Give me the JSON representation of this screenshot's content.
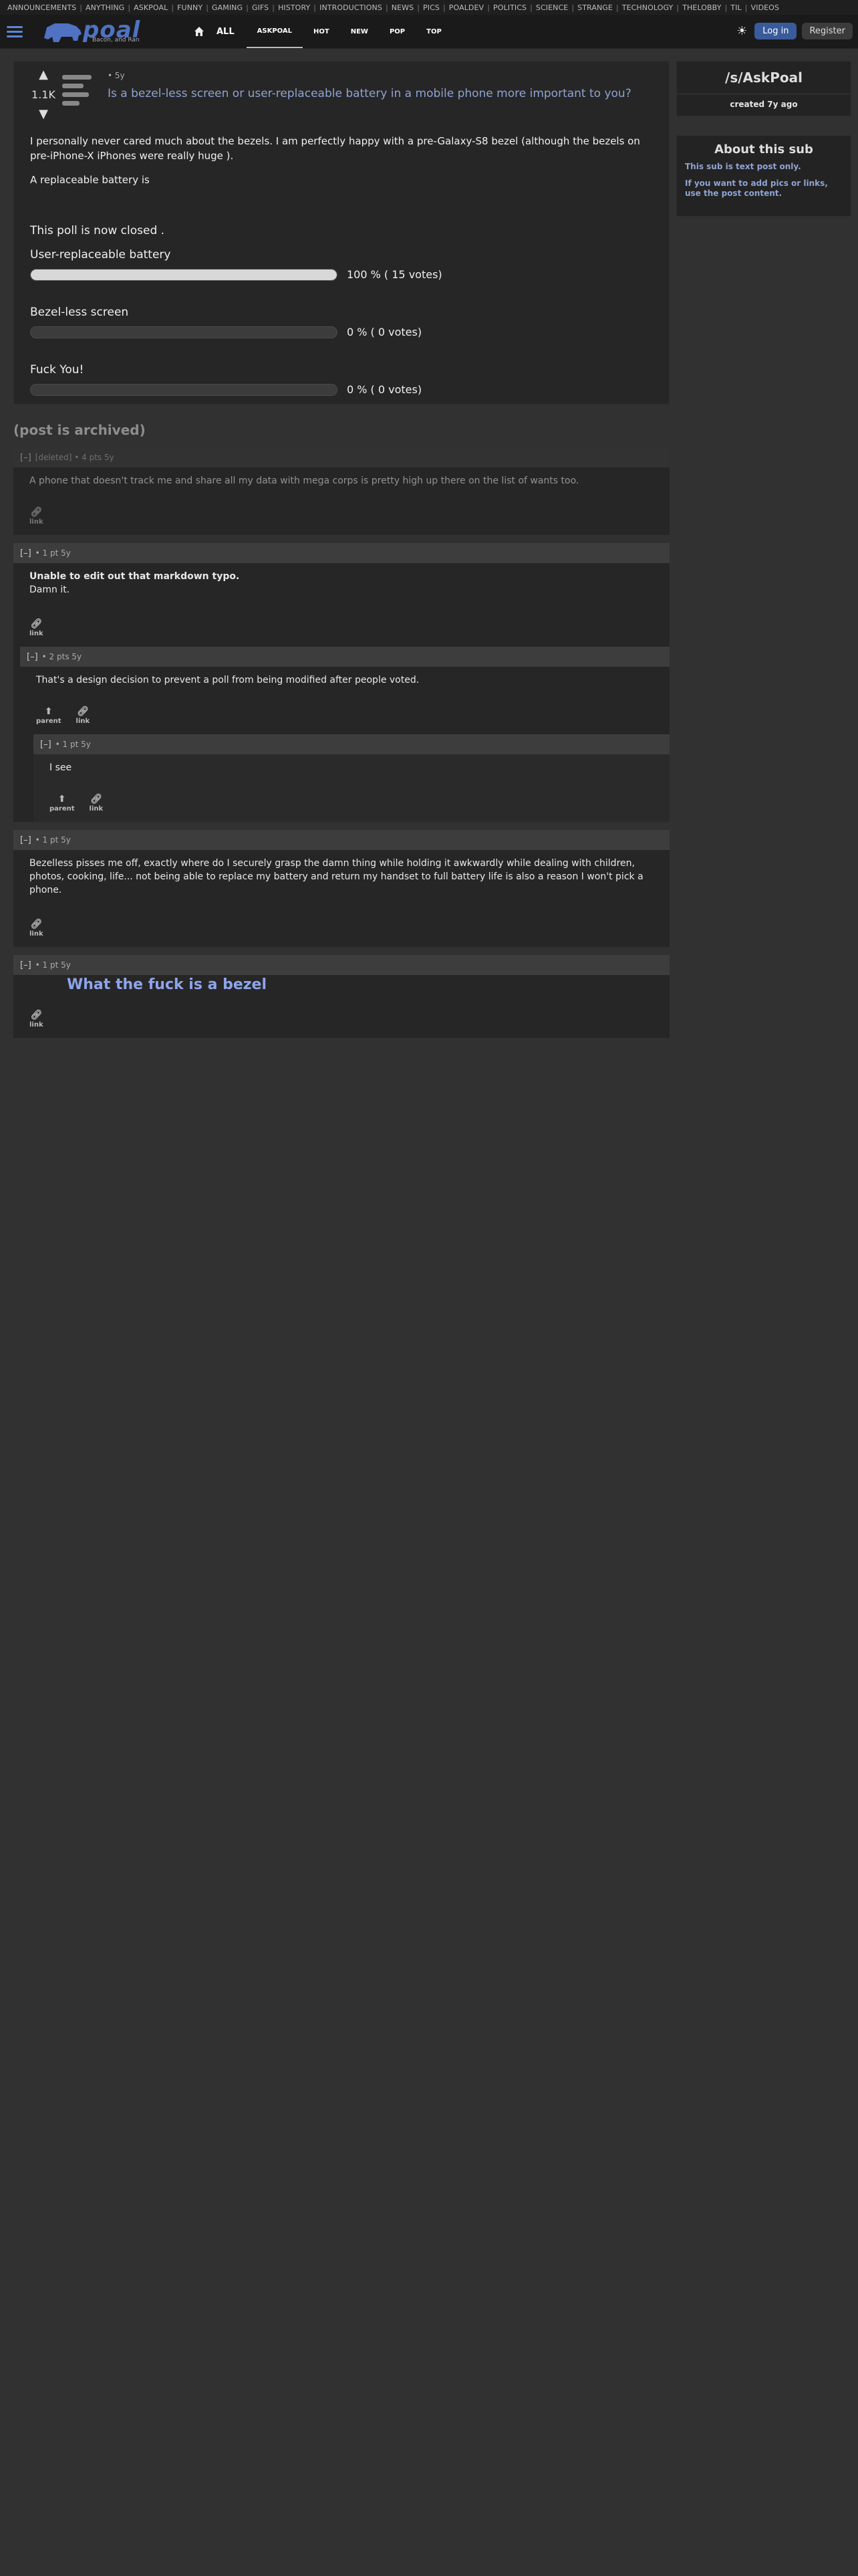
{
  "subs_bar": [
    "ANNOUNCEMENTS",
    "ANYTHING",
    "ASKPOAL",
    "FUNNY",
    "GAMING",
    "GIFS",
    "HISTORY",
    "INTRODUCTIONS",
    "NEWS",
    "PICS",
    "POALDEV",
    "POLITICS",
    "SCIENCE",
    "STRANGE",
    "TECHNOLOGY",
    "THELOBBY",
    "TIL",
    "VIDEOS"
  ],
  "header": {
    "logo_text": "poal",
    "logo_tagline": "Bacon, and Ran",
    "all_label": "ALL",
    "tabs": [
      "ASKPOAL",
      "HOT",
      "NEW",
      "POP",
      "TOP"
    ],
    "login_label": "Log in",
    "register_label": "Register"
  },
  "post": {
    "score": "1.1K",
    "meta": "• 5y",
    "title": "Is a bezel-less screen or user-replaceable battery in a mobile phone more important to you?",
    "body_p1": "I personally never cared much about the bezels. I am perfectly happy with a pre-Galaxy-S8 bezel (although the bezels on pre-iPhone-X iPhones were really huge ).",
    "body_p2": "A replaceable battery is",
    "poll_closed": "This poll is now closed .",
    "poll_options": [
      {
        "label": "User-replaceable battery",
        "result": "100 % ( 15 votes)",
        "fraction": 1.0
      },
      {
        "label": "Bezel-less screen",
        "result": "0 % ( 0 votes)",
        "fraction": 0.0
      },
      {
        "label": "Fuck You!",
        "result": "0 % ( 0 votes)",
        "fraction": 0.0
      }
    ]
  },
  "archived_label": "(post is archived)",
  "comments": {
    "c1_head": "[deleted] • 4 pts 5y",
    "c1_body": "A phone that doesn't track me and share all my data with mega corps is pretty high up there on the list of wants too.",
    "c2_head": "• 1 pt 5y",
    "c2_body_line1": "Unable to edit out that markdown typo.",
    "c2_body_line2": "Damn it.",
    "c3_head": "• 2 pts 5y",
    "c3_body": "That's a design decision to prevent a poll from being modified after people voted.",
    "c4_head": "• 1 pt 5y",
    "c4_body": "I see",
    "c5_head": "• 1 pt 5y",
    "c5_body": "Bezelless pisses me off, exactly where do I securely grasp the damn thing while holding it awkwardly while dealing with children, photos, cooking, life... not being able to replace my battery and return my handset to full battery life is also a reason I won't pick a phone.",
    "c6_head": "• 1 pt 5y",
    "c6_body": "What the fuck is a bezel",
    "toggle": "[–]",
    "link_label": "link",
    "parent_label": "parent"
  },
  "sidebar": {
    "sub_name": "/s/AskPoal",
    "created": "created 7y ago",
    "about_title": "About this sub",
    "about_line1": "This sub is text post only.",
    "about_line2": "If you want to add pics or links, use the post content."
  }
}
